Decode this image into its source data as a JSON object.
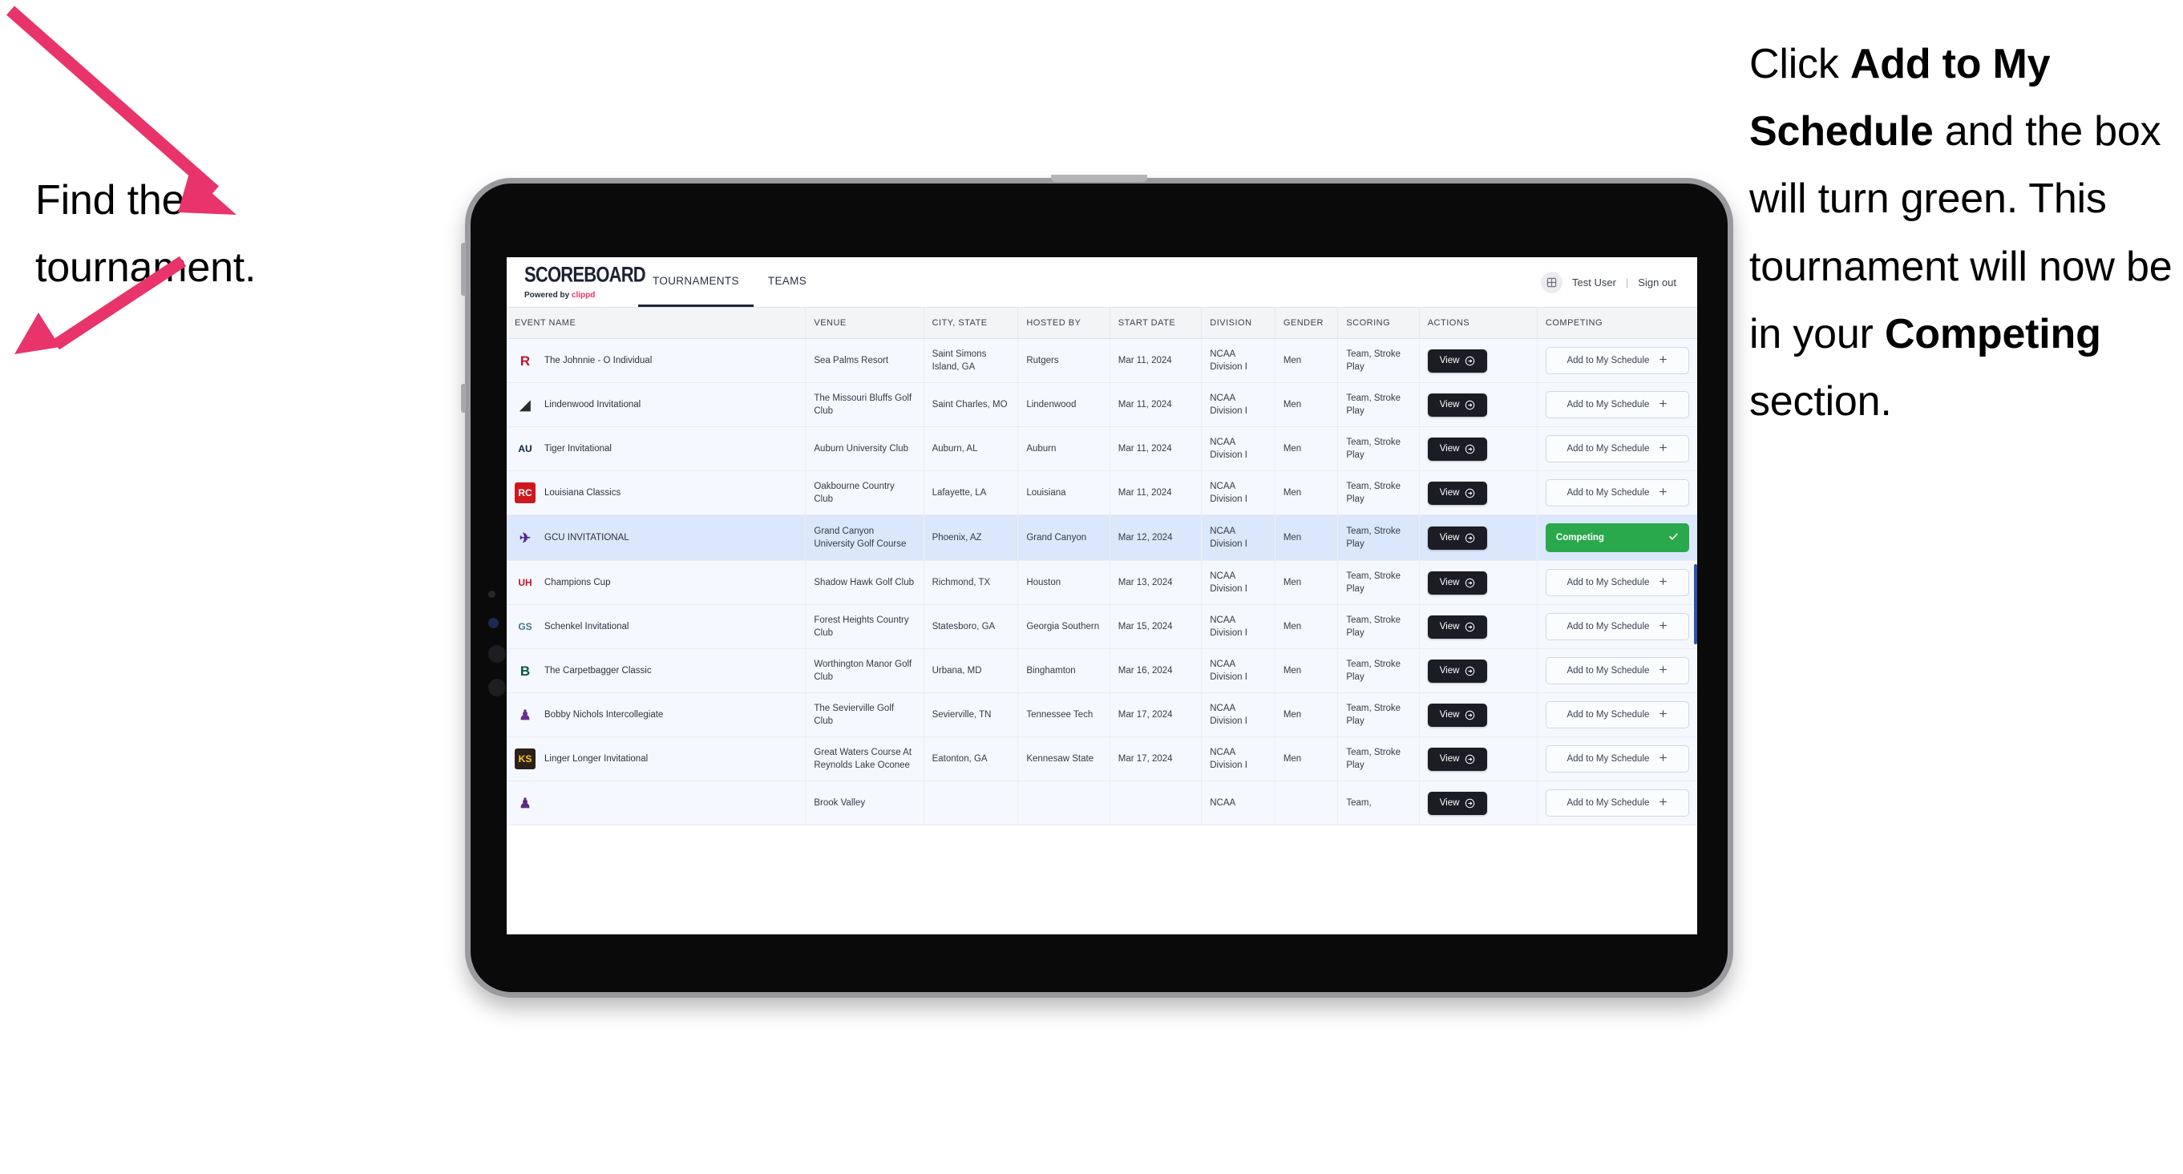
{
  "annotations": {
    "left": "Find the tournament.",
    "right_parts": [
      {
        "text": "Click ",
        "bold": false
      },
      {
        "text": "Add to My Schedule",
        "bold": true
      },
      {
        "text": " and the box will turn green. This tournament will now be in your ",
        "bold": false
      },
      {
        "text": "Competing",
        "bold": true
      },
      {
        "text": " section.",
        "bold": false
      }
    ],
    "arrow_color": "#e8336b"
  },
  "app": {
    "brand": {
      "title": "SCOREBOARD",
      "powered_prefix": "Powered by ",
      "powered_brand": "clippd"
    },
    "nav": [
      {
        "label": "TOURNAMENTS",
        "active": true
      },
      {
        "label": "TEAMS",
        "active": false
      }
    ],
    "header_right": {
      "avatar_icon": "grid-icon",
      "user": "Test User",
      "separator": "|",
      "signout": "Sign out"
    }
  },
  "table": {
    "columns": [
      "EVENT NAME",
      "VENUE",
      "CITY, STATE",
      "HOSTED BY",
      "START DATE",
      "DIVISION",
      "GENDER",
      "SCORING",
      "ACTIONS",
      "COMPETING"
    ],
    "view_label": "View",
    "add_label": "Add to My Schedule",
    "add_icon": "plus-icon",
    "competing_label": "Competing",
    "competing_icon": "check-icon",
    "competing_color": "#2aa84c",
    "rows": [
      {
        "logo": {
          "text": "R",
          "color": "#c8102e",
          "bg": "transparent"
        },
        "event": "The Johnnie - O Individual",
        "venue": "Sea Palms Resort",
        "city": "Saint Simons Island, GA",
        "host": "Rutgers",
        "date": "Mar 11, 2024",
        "division": "NCAA Division I",
        "gender": "Men",
        "scoring": "Team, Stroke Play",
        "competing": false,
        "highlight": false
      },
      {
        "logo": {
          "text": "◢",
          "color": "#2b2b2b",
          "bg": "transparent"
        },
        "event": "Lindenwood Invitational",
        "venue": "The Missouri Bluffs Golf Club",
        "city": "Saint Charles, MO",
        "host": "Lindenwood",
        "date": "Mar 11, 2024",
        "division": "NCAA Division I",
        "gender": "Men",
        "scoring": "Team, Stroke Play",
        "competing": false,
        "highlight": false
      },
      {
        "logo": {
          "text": "AU",
          "color": "#0c2340",
          "bg": "transparent"
        },
        "event": "Tiger Invitational",
        "venue": "Auburn University Club",
        "city": "Auburn, AL",
        "host": "Auburn",
        "date": "Mar 11, 2024",
        "division": "NCAA Division I",
        "gender": "Men",
        "scoring": "Team, Stroke Play",
        "competing": false,
        "highlight": false
      },
      {
        "logo": {
          "text": "RC",
          "color": "#ffffff",
          "bg": "#ce181e"
        },
        "event": "Louisiana Classics",
        "venue": "Oakbourne Country Club",
        "city": "Lafayette, LA",
        "host": "Louisiana",
        "date": "Mar 11, 2024",
        "division": "NCAA Division I",
        "gender": "Men",
        "scoring": "Team, Stroke Play",
        "competing": false,
        "highlight": false
      },
      {
        "logo": {
          "text": "✈",
          "color": "#522398",
          "bg": "transparent"
        },
        "event": "GCU INVITATIONAL",
        "venue": "Grand Canyon University Golf Course",
        "city": "Phoenix, AZ",
        "host": "Grand Canyon",
        "date": "Mar 12, 2024",
        "division": "NCAA Division I",
        "gender": "Men",
        "scoring": "Team, Stroke Play",
        "competing": true,
        "highlight": true
      },
      {
        "logo": {
          "text": "UH",
          "color": "#c8102e",
          "bg": "transparent"
        },
        "event": "Champions Cup",
        "venue": "Shadow Hawk Golf Club",
        "city": "Richmond, TX",
        "host": "Houston",
        "date": "Mar 13, 2024",
        "division": "NCAA Division I",
        "gender": "Men",
        "scoring": "Team, Stroke Play",
        "competing": false,
        "highlight": false
      },
      {
        "logo": {
          "text": "GS",
          "color": "#41748d",
          "bg": "transparent"
        },
        "event": "Schenkel Invitational",
        "venue": "Forest Heights Country Club",
        "city": "Statesboro, GA",
        "host": "Georgia Southern",
        "date": "Mar 15, 2024",
        "division": "NCAA Division I",
        "gender": "Men",
        "scoring": "Team, Stroke Play",
        "competing": false,
        "highlight": false
      },
      {
        "logo": {
          "text": "B",
          "color": "#005a43",
          "bg": "transparent"
        },
        "event": "The Carpetbagger Classic",
        "venue": "Worthington Manor Golf Club",
        "city": "Urbana, MD",
        "host": "Binghamton",
        "date": "Mar 16, 2024",
        "division": "NCAA Division I",
        "gender": "Men",
        "scoring": "Team, Stroke Play",
        "competing": false,
        "highlight": false
      },
      {
        "logo": {
          "text": "♟",
          "color": "#6a2c8f",
          "bg": "transparent"
        },
        "event": "Bobby Nichols Intercollegiate",
        "venue": "The Sevierville Golf Club",
        "city": "Sevierville, TN",
        "host": "Tennessee Tech",
        "date": "Mar 17, 2024",
        "division": "NCAA Division I",
        "gender": "Men",
        "scoring": "Team, Stroke Play",
        "competing": false,
        "highlight": false
      },
      {
        "logo": {
          "text": "KS",
          "color": "#ffc629",
          "bg": "#2b2118"
        },
        "event": "Linger Longer Invitational",
        "venue": "Great Waters Course At Reynolds Lake Oconee",
        "city": "Eatonton, GA",
        "host": "Kennesaw State",
        "date": "Mar 17, 2024",
        "division": "NCAA Division I",
        "gender": "Men",
        "scoring": "Team, Stroke Play",
        "competing": false,
        "highlight": false
      },
      {
        "logo": {
          "text": "♟",
          "color": "#5b2b82",
          "bg": "transparent"
        },
        "event": "",
        "venue": "Brook Valley",
        "city": "",
        "host": "",
        "date": "",
        "division": "NCAA",
        "gender": "",
        "scoring": "Team,",
        "competing": false,
        "highlight": false,
        "clipped": true
      }
    ]
  }
}
